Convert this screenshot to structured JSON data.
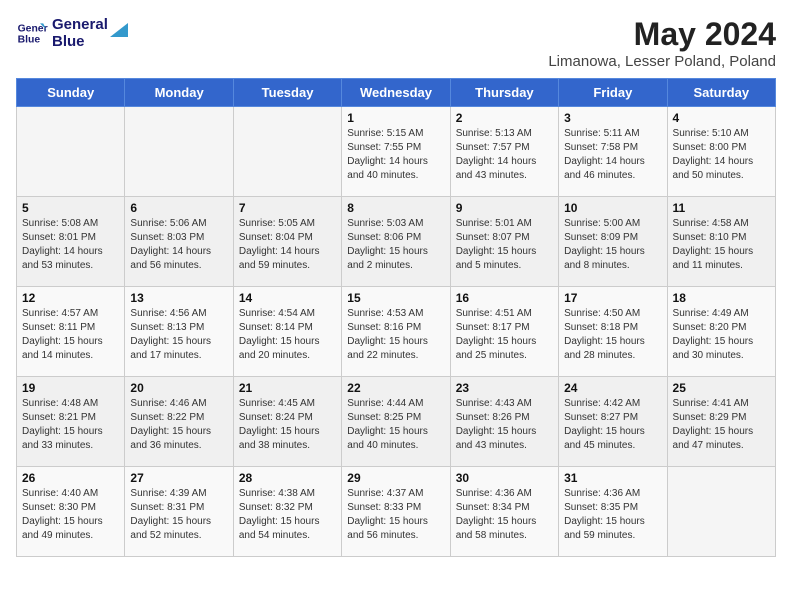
{
  "header": {
    "logo_line1": "General",
    "logo_line2": "Blue",
    "month_year": "May 2024",
    "location": "Limanowa, Lesser Poland, Poland"
  },
  "weekdays": [
    "Sunday",
    "Monday",
    "Tuesday",
    "Wednesday",
    "Thursday",
    "Friday",
    "Saturday"
  ],
  "weeks": [
    [
      {
        "day": "",
        "sunrise": "",
        "sunset": "",
        "daylight": ""
      },
      {
        "day": "",
        "sunrise": "",
        "sunset": "",
        "daylight": ""
      },
      {
        "day": "",
        "sunrise": "",
        "sunset": "",
        "daylight": ""
      },
      {
        "day": "1",
        "sunrise": "Sunrise: 5:15 AM",
        "sunset": "Sunset: 7:55 PM",
        "daylight": "Daylight: 14 hours and 40 minutes."
      },
      {
        "day": "2",
        "sunrise": "Sunrise: 5:13 AM",
        "sunset": "Sunset: 7:57 PM",
        "daylight": "Daylight: 14 hours and 43 minutes."
      },
      {
        "day": "3",
        "sunrise": "Sunrise: 5:11 AM",
        "sunset": "Sunset: 7:58 PM",
        "daylight": "Daylight: 14 hours and 46 minutes."
      },
      {
        "day": "4",
        "sunrise": "Sunrise: 5:10 AM",
        "sunset": "Sunset: 8:00 PM",
        "daylight": "Daylight: 14 hours and 50 minutes."
      }
    ],
    [
      {
        "day": "5",
        "sunrise": "Sunrise: 5:08 AM",
        "sunset": "Sunset: 8:01 PM",
        "daylight": "Daylight: 14 hours and 53 minutes."
      },
      {
        "day": "6",
        "sunrise": "Sunrise: 5:06 AM",
        "sunset": "Sunset: 8:03 PM",
        "daylight": "Daylight: 14 hours and 56 minutes."
      },
      {
        "day": "7",
        "sunrise": "Sunrise: 5:05 AM",
        "sunset": "Sunset: 8:04 PM",
        "daylight": "Daylight: 14 hours and 59 minutes."
      },
      {
        "day": "8",
        "sunrise": "Sunrise: 5:03 AM",
        "sunset": "Sunset: 8:06 PM",
        "daylight": "Daylight: 15 hours and 2 minutes."
      },
      {
        "day": "9",
        "sunrise": "Sunrise: 5:01 AM",
        "sunset": "Sunset: 8:07 PM",
        "daylight": "Daylight: 15 hours and 5 minutes."
      },
      {
        "day": "10",
        "sunrise": "Sunrise: 5:00 AM",
        "sunset": "Sunset: 8:09 PM",
        "daylight": "Daylight: 15 hours and 8 minutes."
      },
      {
        "day": "11",
        "sunrise": "Sunrise: 4:58 AM",
        "sunset": "Sunset: 8:10 PM",
        "daylight": "Daylight: 15 hours and 11 minutes."
      }
    ],
    [
      {
        "day": "12",
        "sunrise": "Sunrise: 4:57 AM",
        "sunset": "Sunset: 8:11 PM",
        "daylight": "Daylight: 15 hours and 14 minutes."
      },
      {
        "day": "13",
        "sunrise": "Sunrise: 4:56 AM",
        "sunset": "Sunset: 8:13 PM",
        "daylight": "Daylight: 15 hours and 17 minutes."
      },
      {
        "day": "14",
        "sunrise": "Sunrise: 4:54 AM",
        "sunset": "Sunset: 8:14 PM",
        "daylight": "Daylight: 15 hours and 20 minutes."
      },
      {
        "day": "15",
        "sunrise": "Sunrise: 4:53 AM",
        "sunset": "Sunset: 8:16 PM",
        "daylight": "Daylight: 15 hours and 22 minutes."
      },
      {
        "day": "16",
        "sunrise": "Sunrise: 4:51 AM",
        "sunset": "Sunset: 8:17 PM",
        "daylight": "Daylight: 15 hours and 25 minutes."
      },
      {
        "day": "17",
        "sunrise": "Sunrise: 4:50 AM",
        "sunset": "Sunset: 8:18 PM",
        "daylight": "Daylight: 15 hours and 28 minutes."
      },
      {
        "day": "18",
        "sunrise": "Sunrise: 4:49 AM",
        "sunset": "Sunset: 8:20 PM",
        "daylight": "Daylight: 15 hours and 30 minutes."
      }
    ],
    [
      {
        "day": "19",
        "sunrise": "Sunrise: 4:48 AM",
        "sunset": "Sunset: 8:21 PM",
        "daylight": "Daylight: 15 hours and 33 minutes."
      },
      {
        "day": "20",
        "sunrise": "Sunrise: 4:46 AM",
        "sunset": "Sunset: 8:22 PM",
        "daylight": "Daylight: 15 hours and 36 minutes."
      },
      {
        "day": "21",
        "sunrise": "Sunrise: 4:45 AM",
        "sunset": "Sunset: 8:24 PM",
        "daylight": "Daylight: 15 hours and 38 minutes."
      },
      {
        "day": "22",
        "sunrise": "Sunrise: 4:44 AM",
        "sunset": "Sunset: 8:25 PM",
        "daylight": "Daylight: 15 hours and 40 minutes."
      },
      {
        "day": "23",
        "sunrise": "Sunrise: 4:43 AM",
        "sunset": "Sunset: 8:26 PM",
        "daylight": "Daylight: 15 hours and 43 minutes."
      },
      {
        "day": "24",
        "sunrise": "Sunrise: 4:42 AM",
        "sunset": "Sunset: 8:27 PM",
        "daylight": "Daylight: 15 hours and 45 minutes."
      },
      {
        "day": "25",
        "sunrise": "Sunrise: 4:41 AM",
        "sunset": "Sunset: 8:29 PM",
        "daylight": "Daylight: 15 hours and 47 minutes."
      }
    ],
    [
      {
        "day": "26",
        "sunrise": "Sunrise: 4:40 AM",
        "sunset": "Sunset: 8:30 PM",
        "daylight": "Daylight: 15 hours and 49 minutes."
      },
      {
        "day": "27",
        "sunrise": "Sunrise: 4:39 AM",
        "sunset": "Sunset: 8:31 PM",
        "daylight": "Daylight: 15 hours and 52 minutes."
      },
      {
        "day": "28",
        "sunrise": "Sunrise: 4:38 AM",
        "sunset": "Sunset: 8:32 PM",
        "daylight": "Daylight: 15 hours and 54 minutes."
      },
      {
        "day": "29",
        "sunrise": "Sunrise: 4:37 AM",
        "sunset": "Sunset: 8:33 PM",
        "daylight": "Daylight: 15 hours and 56 minutes."
      },
      {
        "day": "30",
        "sunrise": "Sunrise: 4:36 AM",
        "sunset": "Sunset: 8:34 PM",
        "daylight": "Daylight: 15 hours and 58 minutes."
      },
      {
        "day": "31",
        "sunrise": "Sunrise: 4:36 AM",
        "sunset": "Sunset: 8:35 PM",
        "daylight": "Daylight: 15 hours and 59 minutes."
      },
      {
        "day": "",
        "sunrise": "",
        "sunset": "",
        "daylight": ""
      }
    ]
  ]
}
